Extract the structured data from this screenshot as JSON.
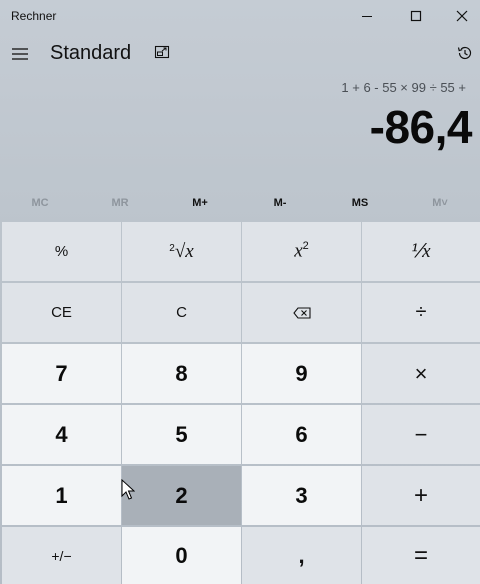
{
  "window": {
    "title": "Rechner",
    "controls": [
      "minimize-icon",
      "maximize-icon",
      "close-icon"
    ]
  },
  "header": {
    "mode": "Standard",
    "menu_icon": "hamburger-icon",
    "keep_on_top_icon": "keep-on-top-icon",
    "history_icon": "history-icon"
  },
  "display": {
    "expression": "1 + 6 - 55 × 99 ÷ 55 +",
    "result": "-86,4"
  },
  "memory": [
    {
      "label": "MC",
      "enabled": false
    },
    {
      "label": "MR",
      "enabled": false
    },
    {
      "label": "M+",
      "enabled": true
    },
    {
      "label": "M-",
      "enabled": true
    },
    {
      "label": "MS",
      "enabled": true
    },
    {
      "label": "M˅",
      "enabled": false
    }
  ],
  "keys": {
    "percent": "%",
    "sqrt": "√x",
    "sqrt_index": "2",
    "square": "x",
    "square_exp": "2",
    "reciprocal": "⅟x",
    "clear_entry": "CE",
    "clear": "C",
    "backspace_icon": "backspace-icon",
    "divide": "÷",
    "seven": "7",
    "eight": "8",
    "nine": "9",
    "multiply": "×",
    "four": "4",
    "five": "5",
    "six": "6",
    "minus": "−",
    "one": "1",
    "two": "2",
    "three": "3",
    "plus": "+",
    "negate": "+/−",
    "zero": "0",
    "decimal": ",",
    "equals": "="
  },
  "colors": {
    "number_key_bg": "#f2f4f6",
    "function_key_bg": "#dfe3e8",
    "pressed_key_bg": "#a9b0b8",
    "display_bg": "#c5ccd4"
  }
}
